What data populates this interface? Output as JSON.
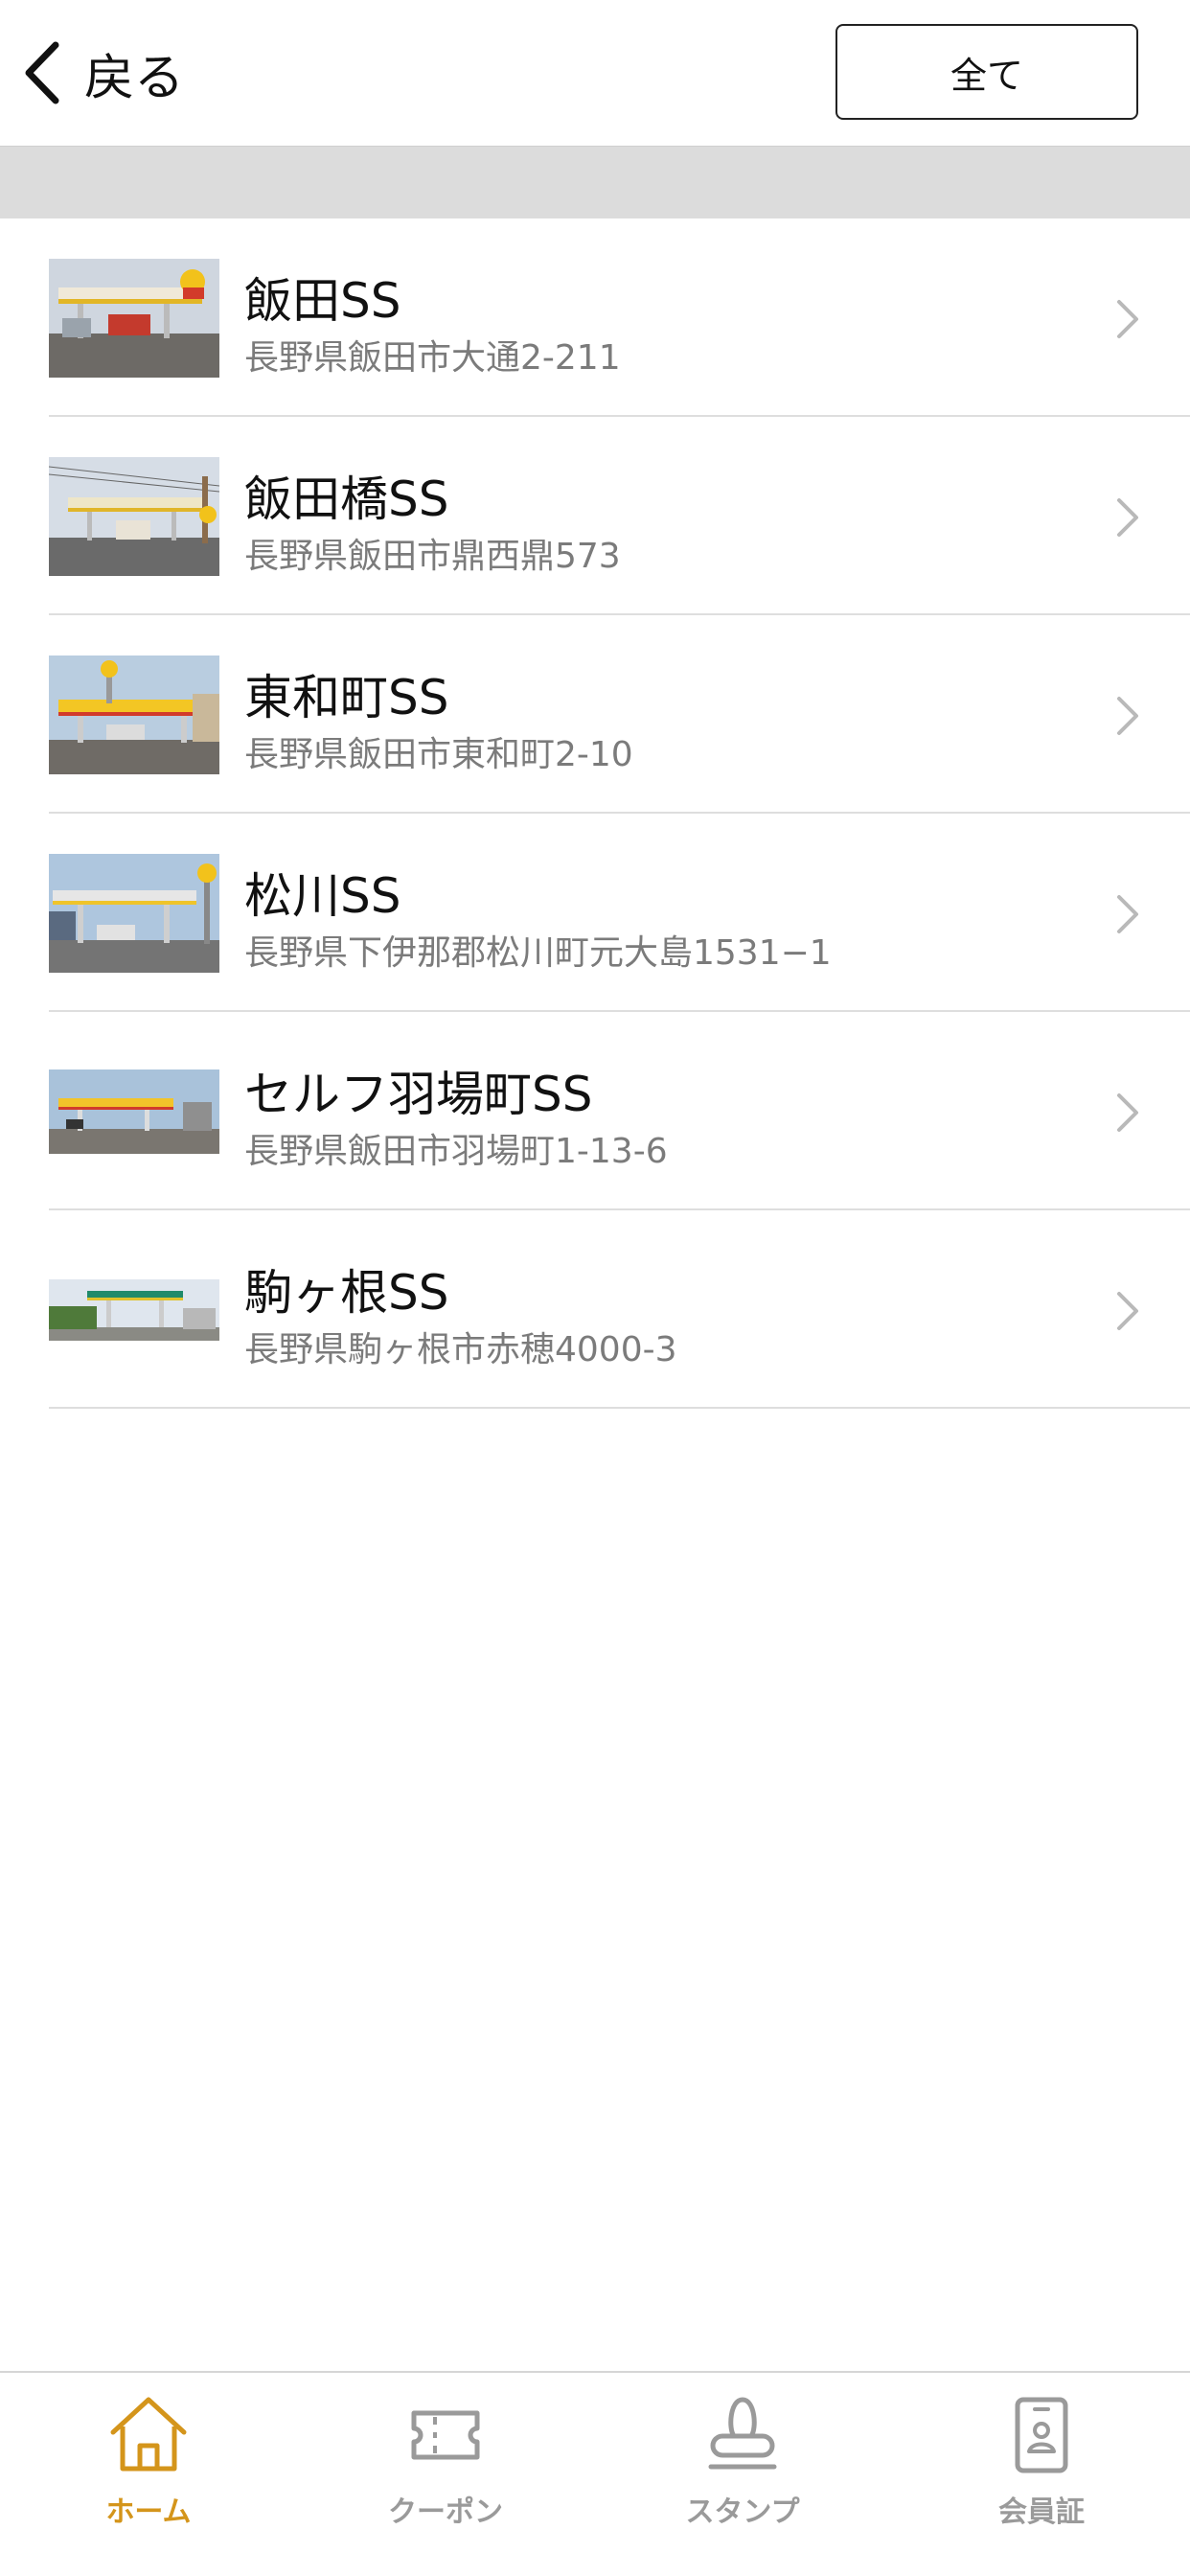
{
  "header": {
    "back_label": "戻る",
    "all_label": "全て"
  },
  "stations": [
    {
      "name": "飯田SS",
      "address": "長野県飯田市大通2-211"
    },
    {
      "name": "飯田橋SS",
      "address": "長野県飯田市鼎西鼎573"
    },
    {
      "name": "東和町SS",
      "address": "長野県飯田市東和町2-10"
    },
    {
      "name": "松川SS",
      "address": "長野県下伊那郡松川町元大島1531−1"
    },
    {
      "name": "セルフ羽場町SS",
      "address": "長野県飯田市羽場町1-13-6"
    },
    {
      "name": "駒ヶ根SS",
      "address": "長野県駒ヶ根市赤穂4000-3"
    }
  ],
  "tabbar": {
    "items": [
      {
        "label": "ホーム",
        "icon": "home-icon",
        "active": true
      },
      {
        "label": "クーポン",
        "icon": "coupon-icon",
        "active": false
      },
      {
        "label": "スタンプ",
        "icon": "stamp-icon",
        "active": false
      },
      {
        "label": "会員証",
        "icon": "member-card-icon",
        "active": false
      }
    ]
  },
  "colors": {
    "accent": "#d4951b",
    "inactive": "#9a9a9a",
    "band": "#dcdcdc"
  }
}
